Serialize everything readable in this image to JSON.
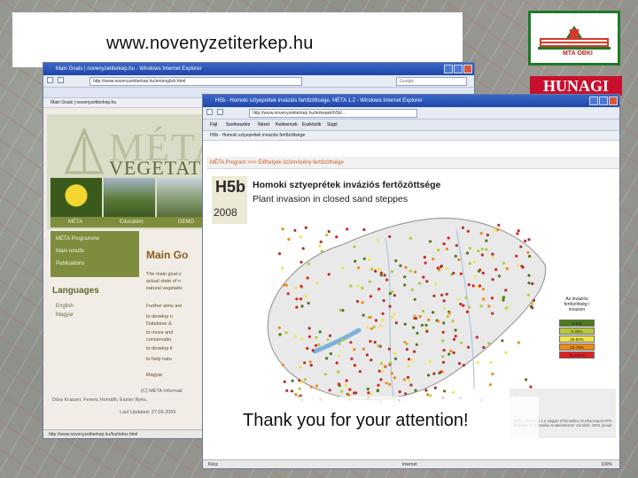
{
  "banner": {
    "url": "www.novenyzetiterkep.hu"
  },
  "logos": {
    "mta_label": "MTA ÖBKI",
    "hunagi_label": "HUNAGI"
  },
  "colors": {
    "accent_green": "#7e8c3d",
    "banner_bg": "#ffffff",
    "hunagi_red": "#c8102e"
  },
  "window1": {
    "title": "Main Goals | novenyzetiterkep.hu - Windows Internet Explorer",
    "address": "http://www.novenyzetiterkep.hu/en/english.html",
    "search": "Google",
    "tab": "Main Goals | novenyzetiterkep.hu",
    "site_title": "MÉTA",
    "site_subtitle": "VEGETAT",
    "nav": [
      "MÉTA",
      "Education",
      "DEMO"
    ],
    "menu": [
      "MÉTA Programme",
      "Main results",
      "Publications"
    ],
    "languages_title": "Languages",
    "languages": [
      "English",
      "Magyar"
    ],
    "heading": "Main Go",
    "paragraphs": [
      "The main goal o",
      "actual state of n",
      "natural vegetatio",
      "Further aims are",
      "to develop n",
      "Database &",
      "to move and",
      "conservatio",
      "to develop it",
      "to help natu",
      "Magyar"
    ],
    "footer_lines": [
      "(C) MÉTA Informati",
      "Dóra Krasser, Ferenc Horváth, Eszter Illyés,",
      "Last Updated: 27.09.2009"
    ],
    "status": "http://www.novenyzetiterkep.hu/hu/index.html"
  },
  "window2": {
    "title": "H5b - Homoki sztyeprétek inváziós fertőzöttsége, MÉTA 1.2 - Windows Internet Explorer",
    "address": "http://www.novenyzetiterkep.hu/terkepek/h5b/...",
    "tab": "H5b - Homoki sztyeprétek inváziós fertőzöttsége",
    "toolbar": [
      "Fájl",
      "Szerkesztés",
      "Nézet",
      "Kedvencek",
      "Eszközök",
      "Súgó"
    ],
    "breadcrumb": "MÉTA Program >>> Élőhelyek özönnövény fertőzöttsége",
    "code": "H5b",
    "year": "2008",
    "title_hu": "Homoki sztyeprétek inváziós fertőzöttsége",
    "title_en": "Plant invasion in closed sand steppes",
    "legend_title": "Az inváziós fertőzöttség / invasion",
    "legend": [
      {
        "label": "0-5%",
        "color": "#4d7a1a"
      },
      {
        "label": "5-25%",
        "color": "#b6c93a"
      },
      {
        "label": "25-50%",
        "color": "#f0e54a"
      },
      {
        "label": "50-75%",
        "color": "#f08a1a"
      },
      {
        "label": "75-100%",
        "color": "#e02020"
      }
    ],
    "footer_note": "MÉTA adatbázis 1.2 alapján Informatikai munkacsoport MTA Ökológiai és Botanikai Kutatóintézete Vácrátót, 2009. január",
    "status_left": "Kész",
    "status_right": "Internet",
    "zoom": "100%"
  },
  "closing": "Thank you for your attention!"
}
